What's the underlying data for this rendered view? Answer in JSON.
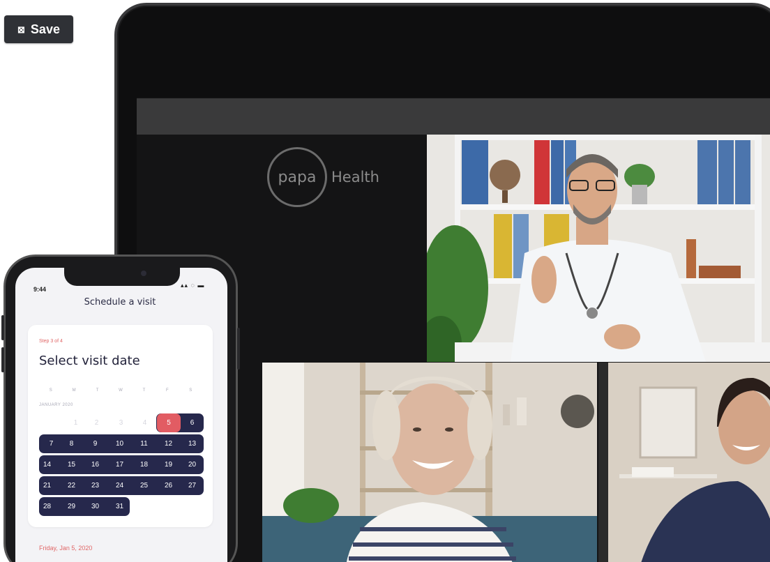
{
  "toolbar": {
    "save_label": "Save",
    "save_icon": "⊠"
  },
  "tablet": {
    "logo_ring_text": "papa",
    "logo_word": "Health"
  },
  "phone": {
    "status_time": "9:44",
    "status_icons": "▴▴ ◌ ▬",
    "title": "Schedule a visit",
    "step_label": "Step 3 of 4",
    "card_title": "Select visit date",
    "weekdays": [
      "S",
      "M",
      "T",
      "W",
      "T",
      "F",
      "S"
    ],
    "month_label": "JANUARY 2020",
    "leading_days": [
      "1",
      "2",
      "3",
      "4"
    ],
    "selected_day": "5",
    "weeks": [
      [
        "6"
      ],
      [
        "7",
        "8",
        "9",
        "10",
        "11",
        "12",
        "13"
      ],
      [
        "14",
        "15",
        "16",
        "17",
        "18",
        "19",
        "20"
      ],
      [
        "21",
        "22",
        "23",
        "24",
        "25",
        "26",
        "27"
      ],
      [
        "28",
        "29",
        "30",
        "31"
      ]
    ],
    "selected_date_text": "Friday, Jan 5, 2020"
  },
  "colors": {
    "accent_navy": "#26284c",
    "accent_red": "#e25c63",
    "tablet_bg": "#0e0e0f"
  }
}
